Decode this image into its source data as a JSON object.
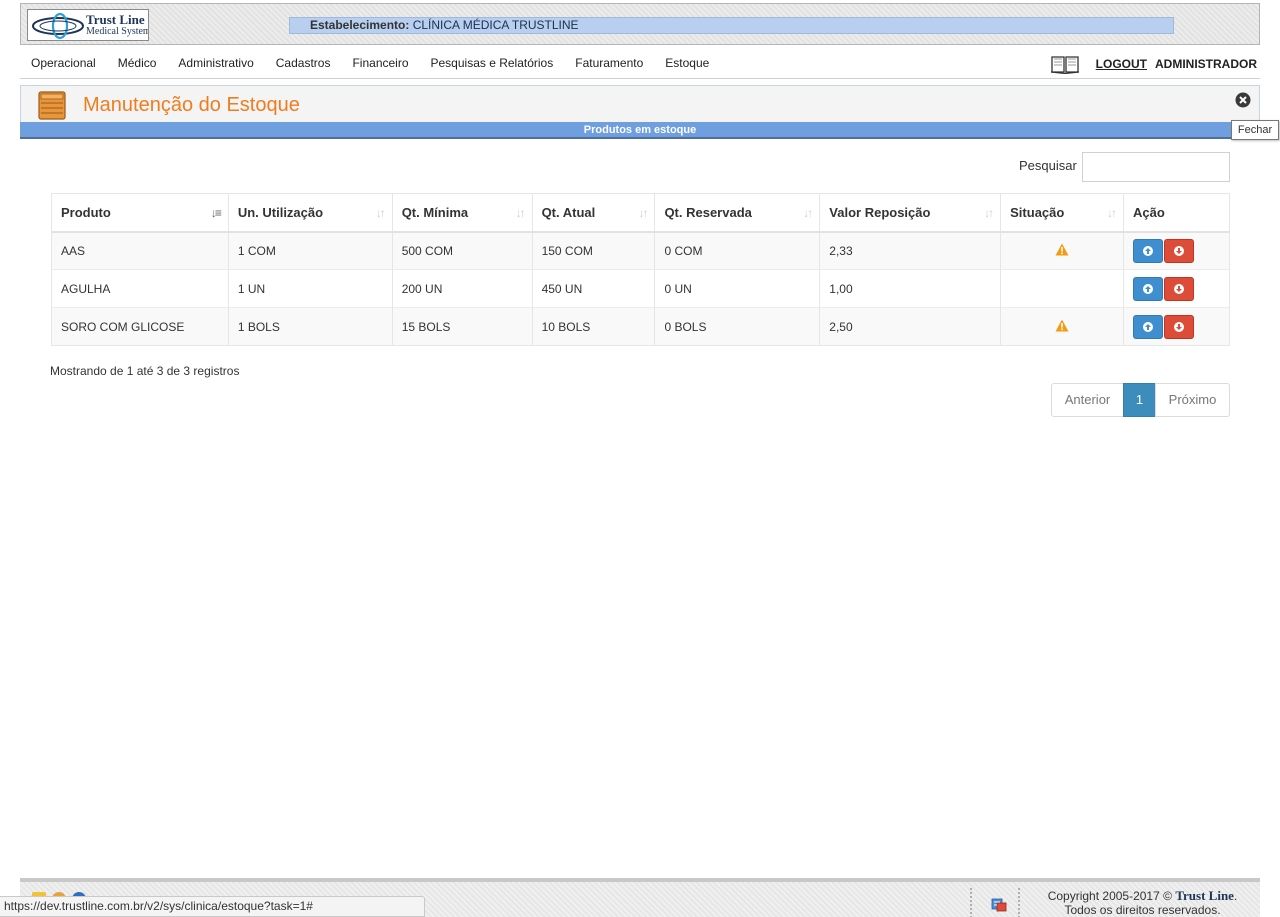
{
  "header": {
    "logo_line1": "Trust Line",
    "logo_line2": "Medical System",
    "estab_label": "Estabelecimento:",
    "estab_value": "CLÍNICA MÉDICA TRUSTLINE"
  },
  "nav": {
    "items": [
      "Operacional",
      "Médico",
      "Administrativo",
      "Cadastros",
      "Financeiro",
      "Pesquisas e Relatórios",
      "Faturamento",
      "Estoque"
    ],
    "logout": "LOGOUT",
    "user": "ADMINISTRADOR"
  },
  "panel": {
    "title": "Manutenção do Estoque",
    "strip": "Produtos em estoque",
    "tooltip": "Fechar"
  },
  "search": {
    "label": "Pesquisar",
    "value": ""
  },
  "table": {
    "headers": [
      "Produto",
      "Un. Utilização",
      "Qt. Mínima",
      "Qt. Atual",
      "Qt. Reservada",
      "Valor Reposição",
      "Situação",
      "Ação"
    ],
    "rows": [
      {
        "produto": "AAS",
        "un": "1 COM",
        "min": "500 COM",
        "atual": "150 COM",
        "reservada": "0 COM",
        "valor": "2,33",
        "warning": true
      },
      {
        "produto": "AGULHA",
        "un": "1 UN",
        "min": "200 UN",
        "atual": "450 UN",
        "reservada": "0 UN",
        "valor": "1,00",
        "warning": false
      },
      {
        "produto": "SORO COM GLICOSE",
        "un": "1 BOLS",
        "min": "15 BOLS",
        "atual": "10 BOLS",
        "reservada": "0 BOLS",
        "valor": "2,50",
        "warning": true
      }
    ]
  },
  "info": "Mostrando de 1 até 3 de 3 registros",
  "pagination": {
    "prev": "Anterior",
    "current": "1",
    "next": "Próximo"
  },
  "footer": {
    "copyright_prefix": "Copyright 2005-2017 ©",
    "brand": "Trust Line",
    "rights": "Todos os direitos reservados."
  },
  "status_url": "https://dev.trustline.com.br/v2/sys/clinica/estoque?task=1#",
  "colors": {
    "title": "#f07c1f",
    "strip": "#6f9fdf",
    "btn_up": "#3f8fd0",
    "btn_down": "#dd4b39",
    "warning": "#f39c12",
    "page_active": "#3c8dbc"
  }
}
